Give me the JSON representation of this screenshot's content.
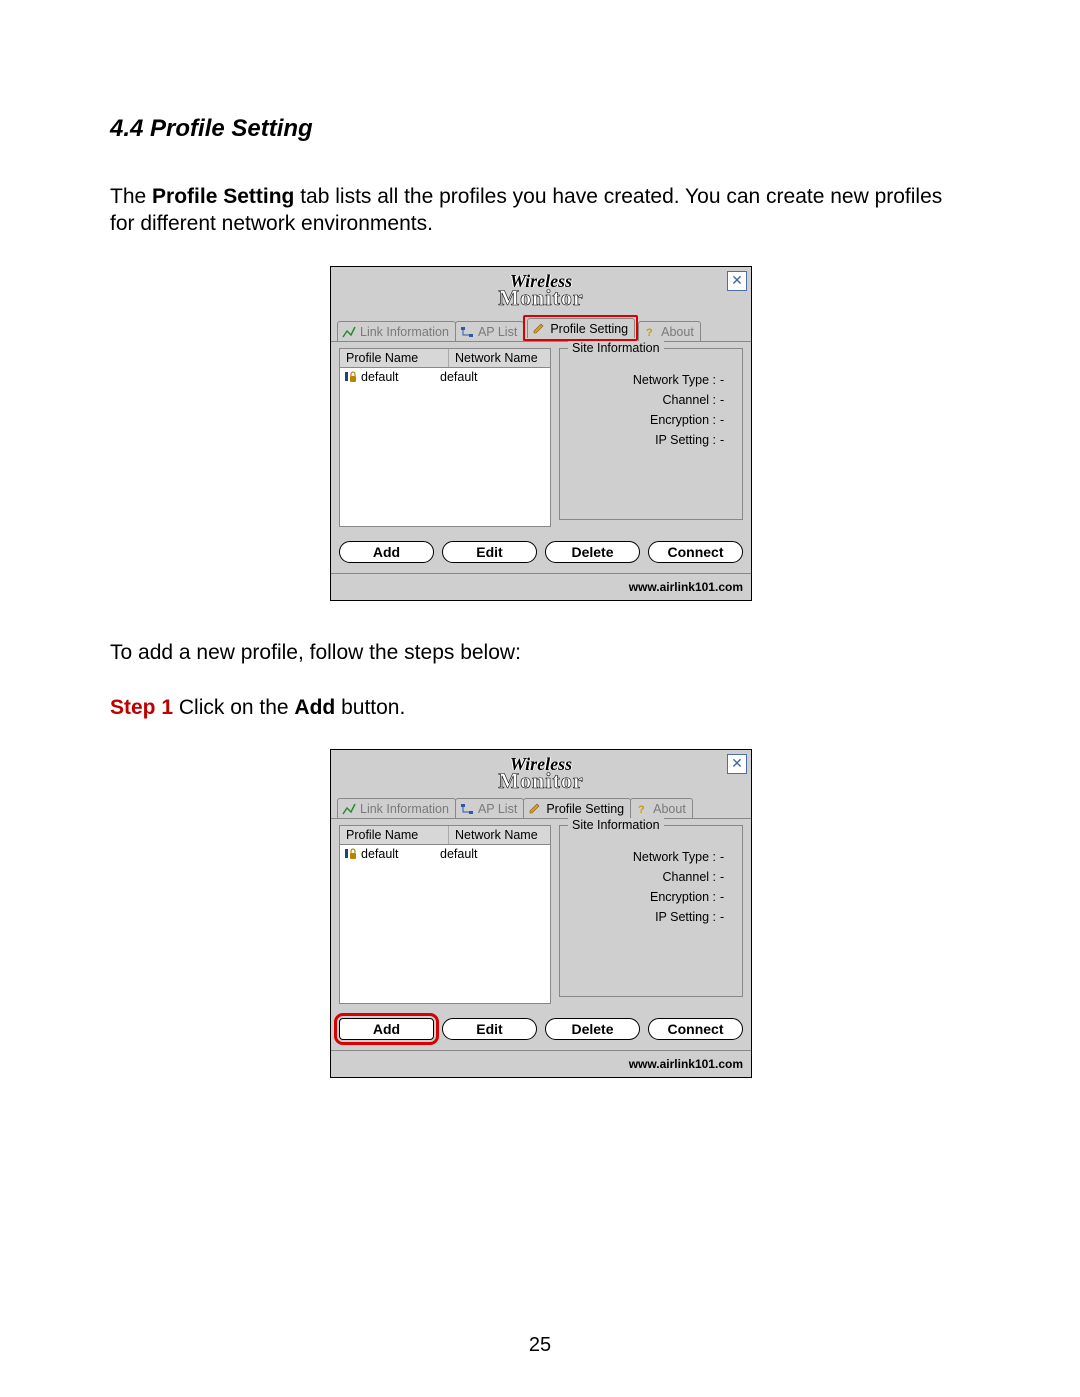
{
  "heading": "4.4 Profile Setting",
  "intro_pre": "The ",
  "intro_bold": "Profile Setting",
  "intro_post": " tab lists all the profiles you have created. You can create new profiles for different network environments.",
  "follow_text": "To add a new profile, follow the steps below:",
  "step1_label": "Step 1",
  "step1_pre": " Click on the ",
  "step1_bold": "Add",
  "step1_post": " button.",
  "page_number": "25",
  "app": {
    "logo_line1": "Wireless",
    "logo_line2": "Monitor",
    "close_glyph": "✕",
    "tabs": {
      "link_info": "Link Information",
      "ap_list": "AP List",
      "profile_setting": "Profile Setting",
      "about": "About"
    },
    "columns": {
      "profile_name": "Profile Name",
      "network_name": "Network Name"
    },
    "row": {
      "profile_name": "default",
      "network_name": "default"
    },
    "group_title": "Site Information",
    "kv": {
      "network_type_k": "Network Type :",
      "network_type_v": "-",
      "channel_k": "Channel :",
      "channel_v": "-",
      "encryption_k": "Encryption :",
      "encryption_v": "-",
      "ip_setting_k": "IP Setting :",
      "ip_setting_v": "-"
    },
    "buttons": {
      "add": "Add",
      "edit": "Edit",
      "delete": "Delete",
      "connect": "Connect"
    },
    "footer_url": "www.airlink101.com"
  }
}
